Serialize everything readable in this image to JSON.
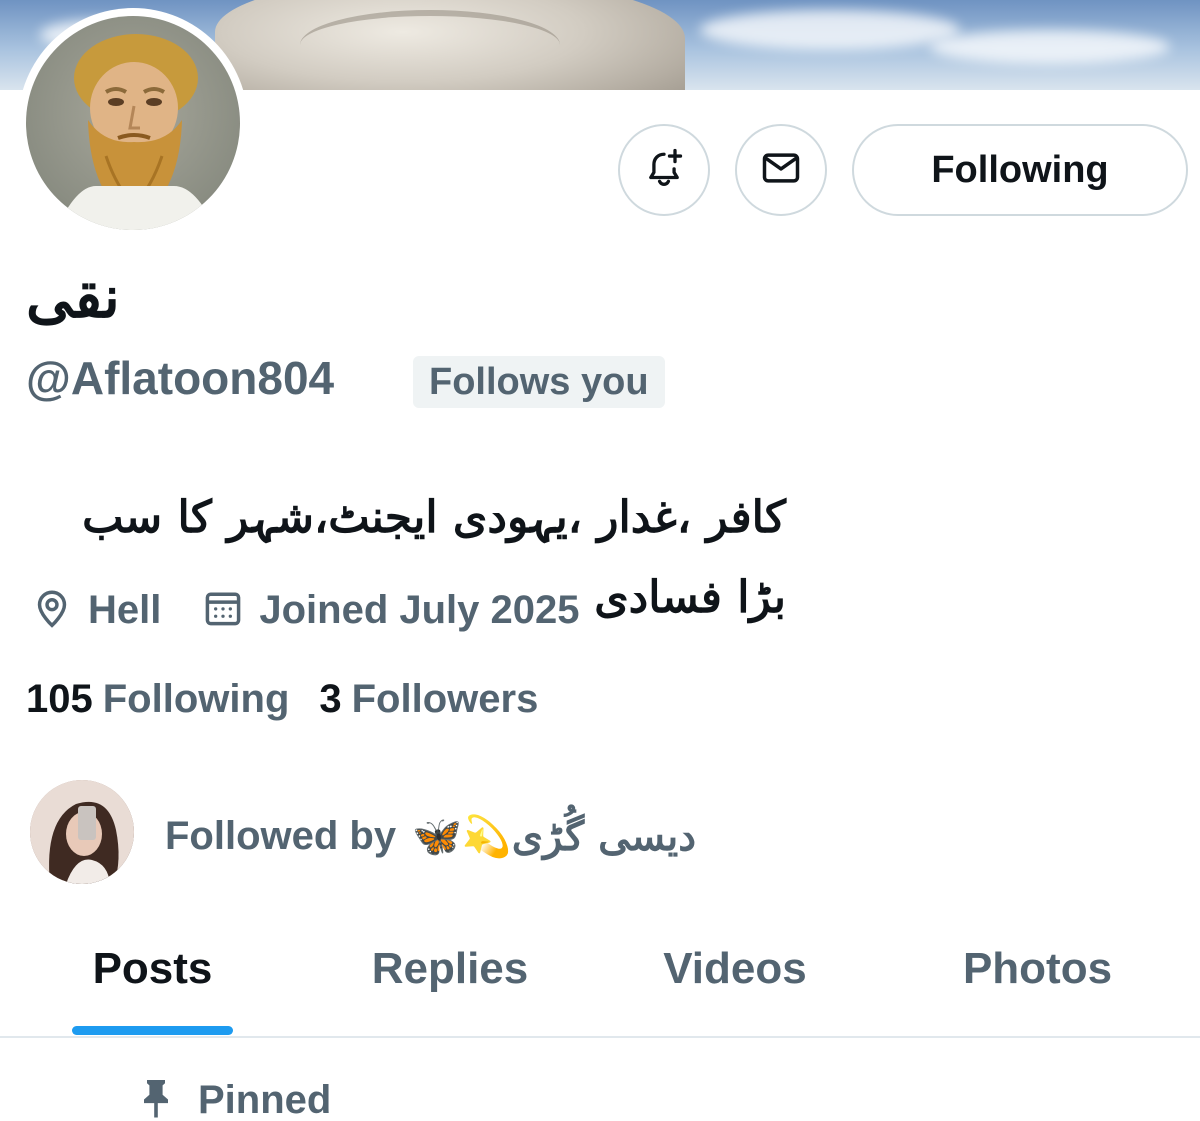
{
  "profile": {
    "display_name": "نقی",
    "handle": "@Aflatoon804",
    "follows_you_badge": "Follows you",
    "bio": "کافر ،غدار ،یہودی ایجنٹ،شہر کا سب بڑا فسادی",
    "location": "Hell",
    "joined": "Joined July 2025"
  },
  "actions": {
    "notify_icon": "bell-plus-icon",
    "message_icon": "envelope-icon",
    "follow_label": "Following"
  },
  "stats": {
    "following_count": "105",
    "following_label": "Following",
    "followers_count": "3",
    "followers_label": "Followers"
  },
  "followed_by": {
    "prefix": "Followed by",
    "name": "🦋💫دیسی گُڑی"
  },
  "tabs": [
    {
      "label": "Posts",
      "active": true
    },
    {
      "label": "Replies",
      "active": false
    },
    {
      "label": "Videos",
      "active": false
    },
    {
      "label": "Photos",
      "active": false
    }
  ],
  "pinned": {
    "label": "Pinned"
  },
  "colors": {
    "accent": "#1d9bf0",
    "text_primary": "#0f1419",
    "text_secondary": "#536471",
    "border": "#cfd9de",
    "badge_bg": "#eff3f4"
  }
}
